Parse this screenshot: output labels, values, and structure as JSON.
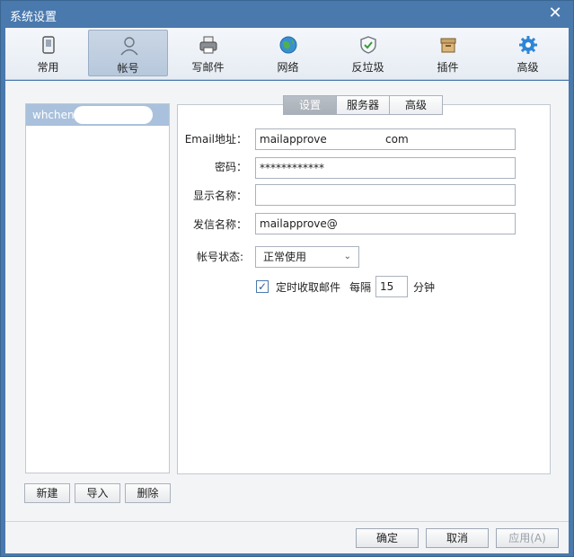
{
  "window": {
    "title": "系统设置",
    "close_icon": "close-icon"
  },
  "toolbar": {
    "items": [
      {
        "label": "常用",
        "icon": "phone-icon"
      },
      {
        "label": "帐号",
        "icon": "user-icon"
      },
      {
        "label": "写邮件",
        "icon": "printer-icon"
      },
      {
        "label": "网络",
        "icon": "globe-icon"
      },
      {
        "label": "反垃圾",
        "icon": "shield-icon"
      },
      {
        "label": "插件",
        "icon": "box-icon"
      },
      {
        "label": "高级",
        "icon": "gear-icon"
      }
    ],
    "active": "帐号"
  },
  "accounts": {
    "items": [
      {
        "label": "whchen"
      }
    ]
  },
  "left_buttons": {
    "new": "新建",
    "import": "导入",
    "delete": "删除"
  },
  "tabs": {
    "items": [
      "设置",
      "服务器",
      "高级"
    ],
    "active": "设置"
  },
  "form": {
    "email": {
      "label": "Email地址：",
      "value": "mailapprove",
      "suffix": "com"
    },
    "password": {
      "label": "密码：",
      "value": "************"
    },
    "display_name": {
      "label": "显示名称：",
      "value": ""
    },
    "sender_name": {
      "label": "发信名称：",
      "value": "mailapprove@"
    },
    "status": {
      "label": "帐号状态:",
      "value": "正常使用"
    },
    "schedule": {
      "checkbox_label": "定时收取邮件",
      "checked": true,
      "every_label": "每隔",
      "interval": "15",
      "unit": "分钟"
    }
  },
  "footer": {
    "ok": "确定",
    "cancel": "取消",
    "apply": "应用(A)"
  },
  "colors": {
    "titlebar": "#4a79ad",
    "selected": "#a9c1dc"
  }
}
